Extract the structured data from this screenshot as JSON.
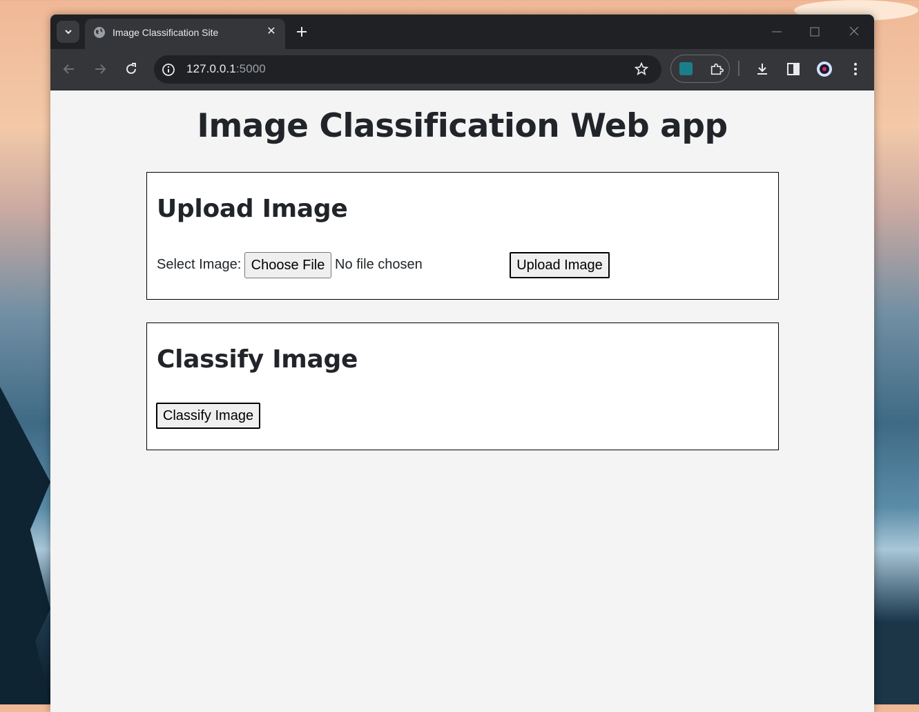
{
  "browser": {
    "tab_title": "Image Classification Site",
    "url_host": "127.0.0.1",
    "url_port": ":5000"
  },
  "page": {
    "title": "Image Classification Web app",
    "upload_section": {
      "heading": "Upload Image",
      "select_label": "Select Image:",
      "choose_file_label": "Choose File",
      "file_status": "No file chosen",
      "upload_button": "Upload Image"
    },
    "classify_section": {
      "heading": "Classify Image",
      "classify_button": "Classify Image"
    }
  },
  "icons": {
    "tab_menu": "chevron-down-icon",
    "favicon": "globe-icon",
    "tab_close": "close-icon",
    "new_tab": "plus-icon",
    "back": "back-arrow-icon",
    "forward": "forward-arrow-icon",
    "reload": "reload-icon",
    "site_info": "info-icon",
    "bookmark": "star-icon",
    "extension": "puzzle-icon",
    "download": "download-icon",
    "side_panel": "side-panel-icon",
    "profile": "avatar",
    "menu": "kebab-menu-icon"
  }
}
